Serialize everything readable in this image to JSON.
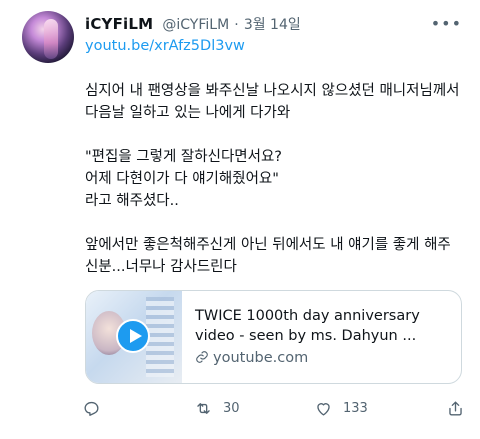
{
  "author": {
    "name": "iCYFiLM",
    "handle": "@iCYFiLM",
    "separator": "·",
    "date": "3월 14일"
  },
  "link": "youtu.be/xrAfz5Dl3vw",
  "tweet_lines": [
    "심지어 내 팬영상을 봐주신날 나오시지 않으셨던 매니저님께서",
    "다음날 일하고 있는 나에게 다가와",
    "\"편집을 그렇게 잘하신다면서요?",
    "어제 다현이가 다 얘기해줬어요\"",
    "라고 해주셨다..",
    "앞에서만 좋은척해주신게 아닌 뒤에서도 내 얘기를 좋게 해주",
    "신분...너무나 감사드린다"
  ],
  "card": {
    "title": "TWICE 1000th day anniversary video - seen by ms. Dahyun ...",
    "domain": "youtube.com"
  },
  "actions": {
    "retweet_count": "30",
    "like_count": "133"
  },
  "colors": {
    "accent": "#1d9bf0",
    "muted": "#536471",
    "border": "#cfd9de"
  }
}
